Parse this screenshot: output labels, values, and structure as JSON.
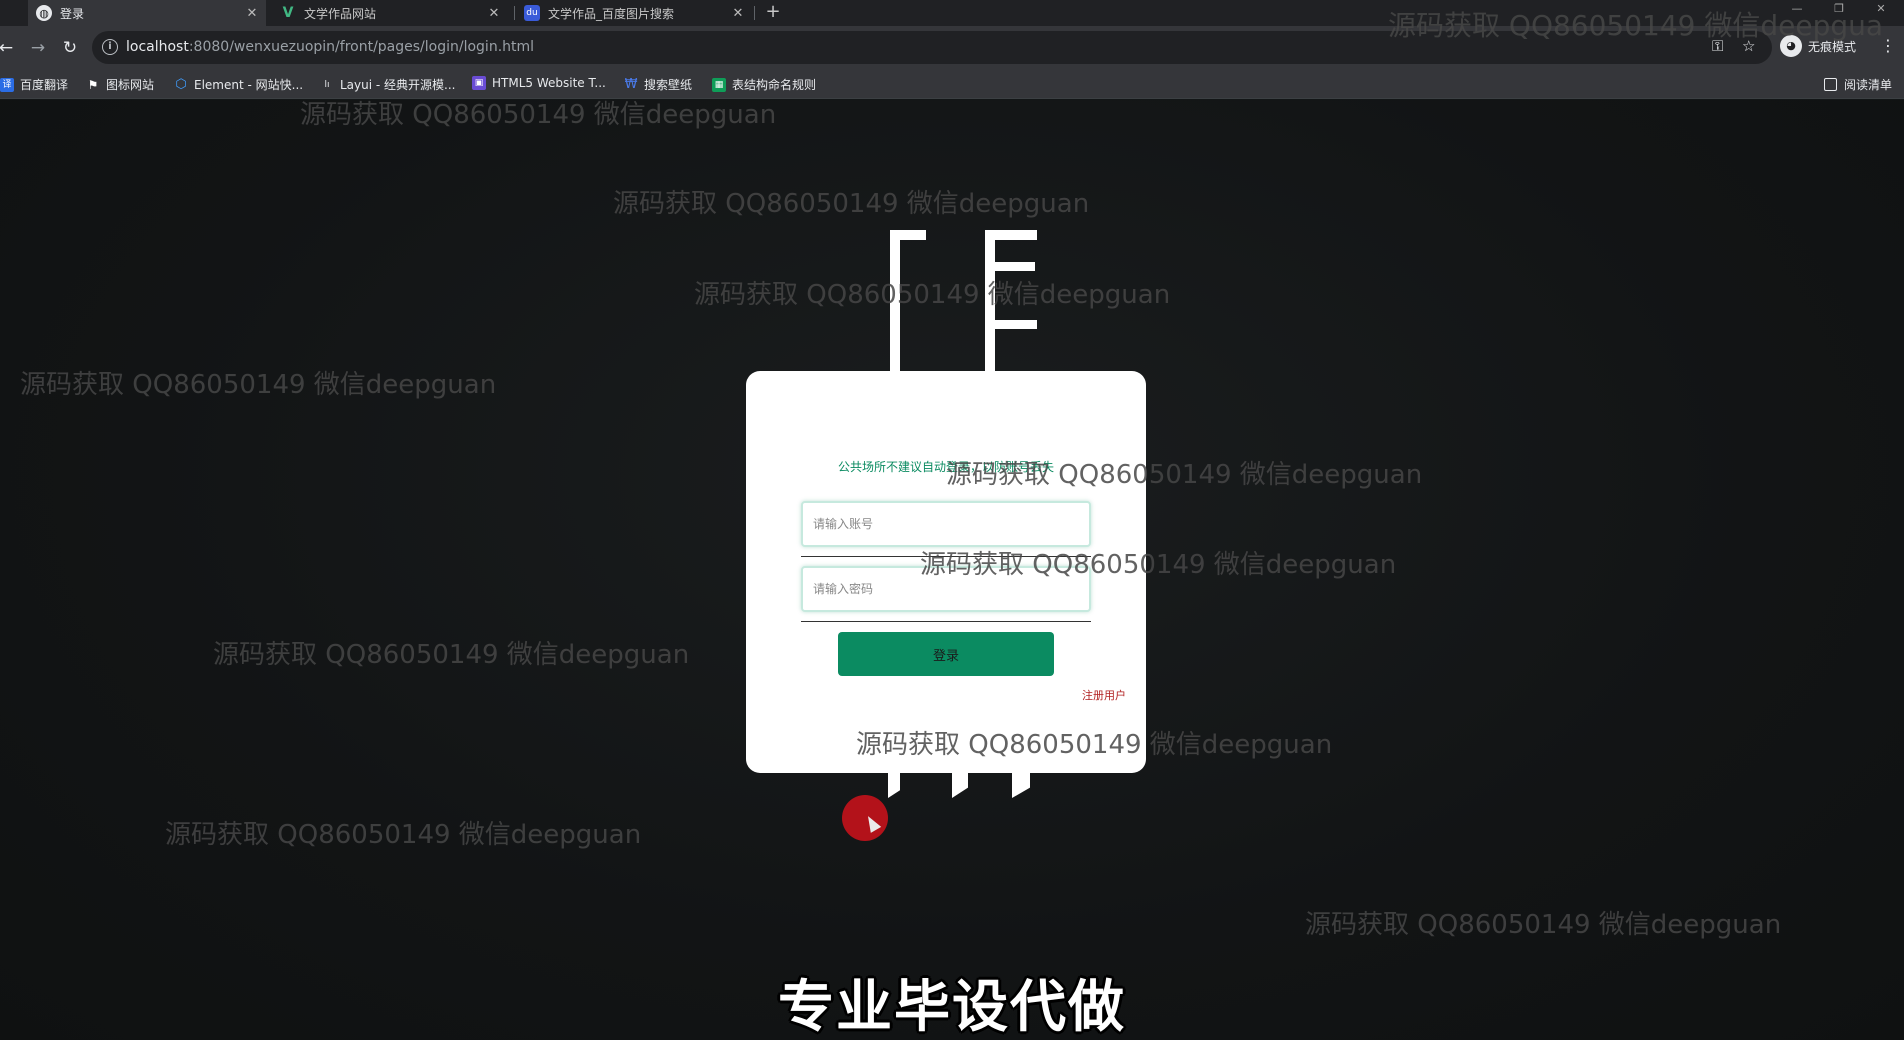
{
  "browser": {
    "tabs": [
      {
        "title": "登录",
        "active": true,
        "icon": "globe-icon"
      },
      {
        "title": "文学作品网站",
        "active": false,
        "icon": "vue-icon"
      },
      {
        "title": "文学作品_百度图片搜索",
        "active": false,
        "icon": "baidu-icon"
      }
    ],
    "url_host": "localhost",
    "url_path": ":8080/wenxuezuopin/front/pages/login/login.html",
    "profile_label": "无痕模式",
    "bookmarks": [
      {
        "label": "百度翻译",
        "icon": "translate-icon",
        "color": "#2b6de5"
      },
      {
        "label": "图标网站",
        "icon": "flag-icon",
        "color": "#ffffff"
      },
      {
        "label": "Element - 网站快...",
        "icon": "element-icon",
        "color": "#409eff"
      },
      {
        "label": "Layui - 经典开源模...",
        "icon": "layui-icon",
        "color": "#e8eaed"
      },
      {
        "label": "HTML5 Website T...",
        "icon": "html5-icon",
        "color": "#6a4cd4"
      },
      {
        "label": "搜索壁纸",
        "icon": "wallpaper-icon",
        "color": "#4a7ae8"
      },
      {
        "label": "表结构命名规则",
        "icon": "sheet-icon",
        "color": "#0f9d58"
      }
    ],
    "reading_list": "阅读清单"
  },
  "login": {
    "tip": "公共场所不建议自动登录，以防账号丢失",
    "username_placeholder": "请输入账号",
    "password_placeholder": "请输入密码",
    "login_button": "登录",
    "register_link": "注册用户",
    "accent_color": "#0b8b61"
  },
  "watermark": "源码获取 QQ86050149 微信deepguan",
  "watermark_top_right": "源码获取 QQ86050149 微信deepgua",
  "caption": "专业毕设代做"
}
